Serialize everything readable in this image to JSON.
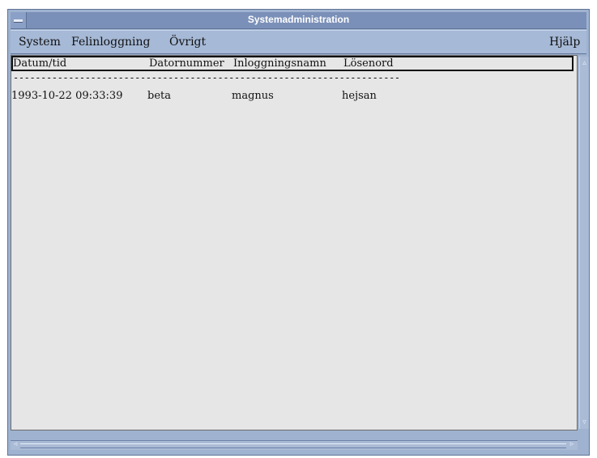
{
  "window": {
    "title": "Systemadministration"
  },
  "menubar": {
    "items": [
      "System",
      "Felinloggning",
      "Övrigt"
    ],
    "help": "Hjälp"
  },
  "table": {
    "columns": [
      "Datum/tid",
      "Datornummer",
      "Inloggningsnamn",
      "Lösenord"
    ],
    "separator": "--------------------------------------------------------------------------",
    "rows": [
      [
        "1993-10-22 09:33:39",
        "beta",
        "magnus",
        "hejsan"
      ]
    ]
  },
  "scrollbars": {
    "up_icon": "triangle-up",
    "down_icon": "triangle-down",
    "left_icon": "triangle-left",
    "right_icon": "triangle-right"
  },
  "colors": {
    "window_frame": "#9fb3d0",
    "titlebar": "#7b90b8",
    "content_bg": "#e6e6e6"
  }
}
